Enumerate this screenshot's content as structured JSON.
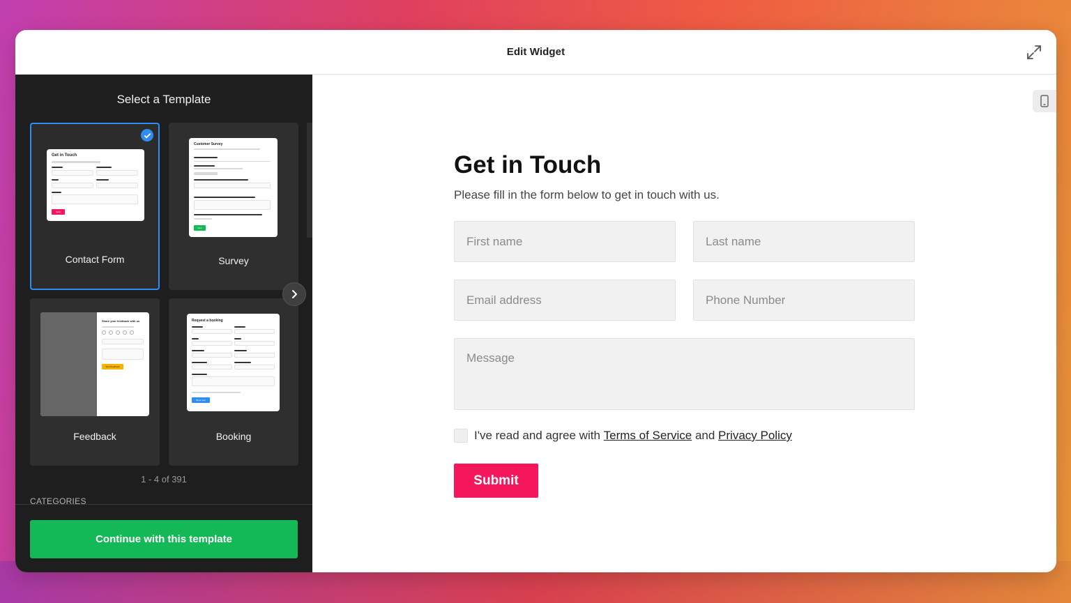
{
  "window": {
    "title": "Edit Widget"
  },
  "sidebar": {
    "title": "Select a Template",
    "templates": [
      {
        "label": "Contact Form",
        "selected": true
      },
      {
        "label": "Survey",
        "selected": false
      },
      {
        "label": "Feedback",
        "selected": false
      },
      {
        "label": "Booking",
        "selected": false
      }
    ],
    "thumbnails": {
      "contact_title": "Get in Touch",
      "contact_send": "Send",
      "survey_title": "Customer Survey",
      "survey_next": "Next",
      "feedback_title": "Share your feedback with us",
      "feedback_send": "Send feedback",
      "booking_title": "Request a booking",
      "booking_send": "Book now"
    },
    "pager": "1 - 4 of 391",
    "categories_label": "CATEGORIES",
    "continue_label": "Continue with this template"
  },
  "form": {
    "title": "Get in Touch",
    "subtitle": "Please fill in the form below to get in touch with us.",
    "first_name_placeholder": "First name",
    "last_name_placeholder": "Last name",
    "email_placeholder": "Email address",
    "phone_placeholder": "Phone Number",
    "message_placeholder": "Message",
    "agree_prefix": "I've read and agree with ",
    "terms_link": "Terms of Service",
    "agree_and": " and ",
    "privacy_link": "Privacy Policy",
    "submit_label": "Submit"
  },
  "colors": {
    "accent_blue": "#2f8df0",
    "continue_green": "#14b856",
    "submit_pink": "#f5175b",
    "sidebar_bg": "#1e1e1e"
  },
  "icons": {
    "expand": "expand-icon",
    "check": "check-icon",
    "next": "chevron-right-icon",
    "device": "mobile-device-icon"
  }
}
